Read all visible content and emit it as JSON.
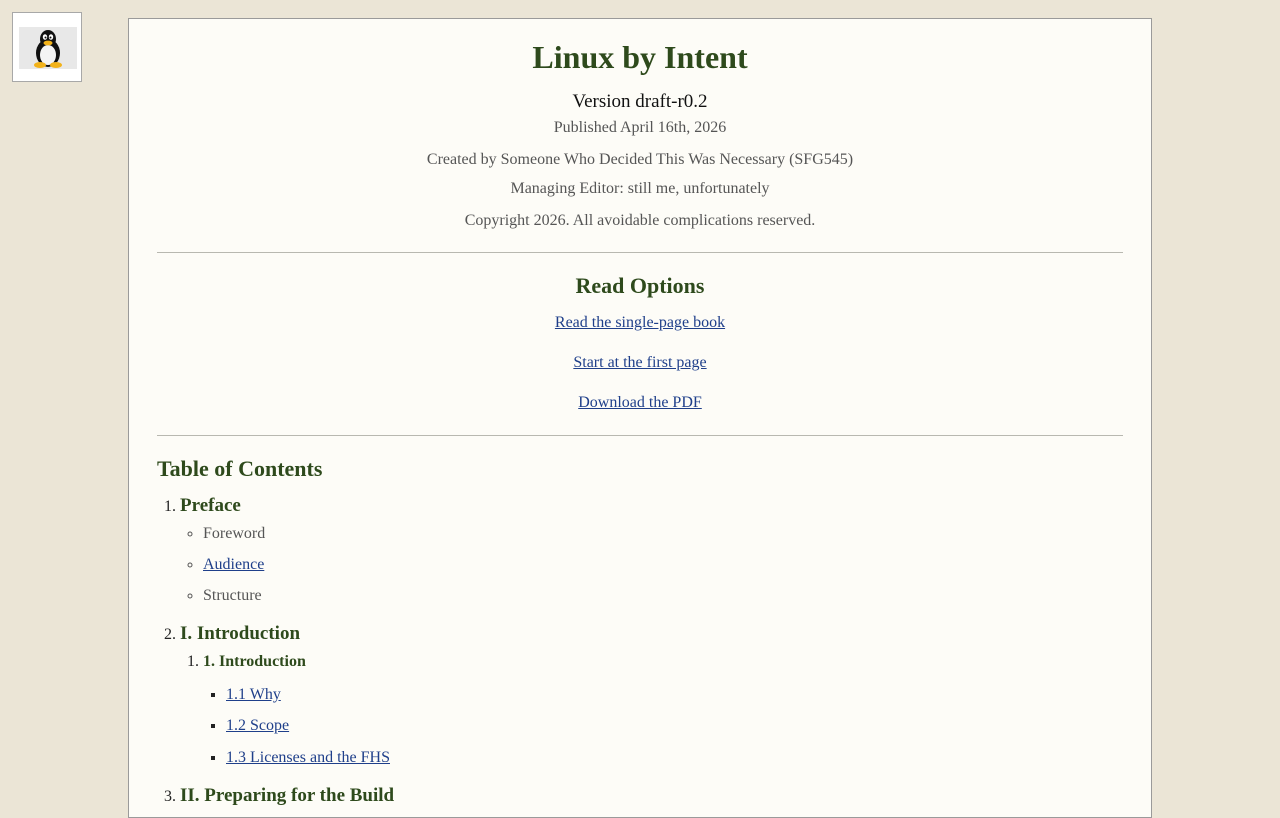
{
  "book": {
    "title": "Linux by Intent",
    "version": "Version draft-r0.2",
    "published": "Published April 16th, 2026",
    "author": "Created by Someone Who Decided This Was Necessary (SFG545)",
    "editor": "Managing Editor: still me, unfortunately",
    "copyright": "Copyright 2026. All avoidable complications reserved."
  },
  "logo": {
    "icon": "tux-penguin-icon"
  },
  "read_options": {
    "heading": "Read Options",
    "single_page": "Read the single-page book",
    "first_page": "Start at the first page",
    "pdf": "Download the PDF"
  },
  "toc": {
    "heading": "Table of Contents",
    "preface": {
      "title": "Preface",
      "items": [
        "Foreword",
        "Audience",
        "Structure"
      ]
    },
    "part1": {
      "title": "I. Introduction",
      "chapter": "1. Introduction",
      "sections": [
        "1.1 Why",
        "1.2 Scope",
        "1.3 Licenses and the FHS"
      ]
    },
    "part2": {
      "title": "II. Preparing for the Build"
    }
  },
  "colors": {
    "page_bg": "#ebe5d6",
    "content_bg": "#fdfcf7",
    "heading_green": "#2e4a1c",
    "link_blue": "#1f3f8a"
  }
}
